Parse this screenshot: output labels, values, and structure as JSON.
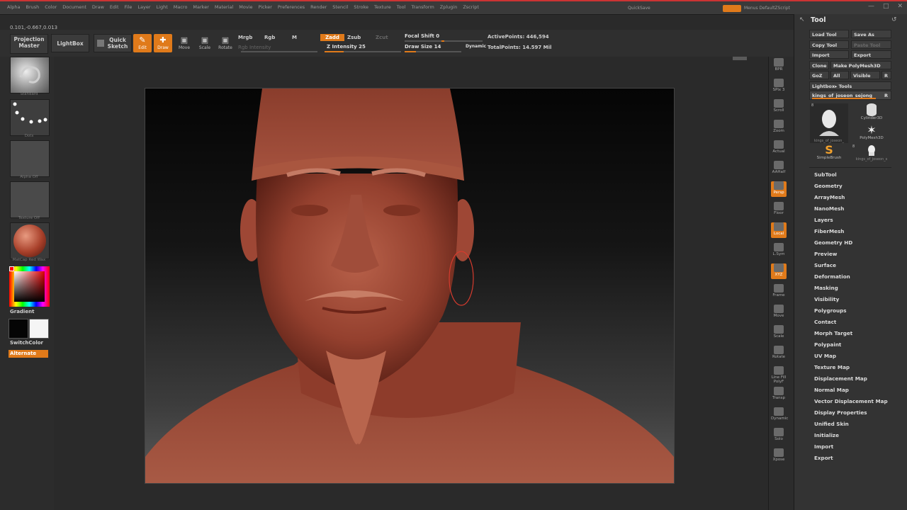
{
  "menu": {
    "items": [
      "Alpha",
      "Brush",
      "Color",
      "Document",
      "Draw",
      "Edit",
      "File",
      "Layer",
      "Light",
      "Macro",
      "Marker",
      "Material",
      "Movie",
      "Picker",
      "Preferences",
      "Render",
      "Stencil",
      "Stroke",
      "Texture",
      "Tool",
      "Transform",
      "Zplugin",
      "Zscript"
    ],
    "coords": "0.101,-0.667,0.013",
    "right_tag": "QuickSave",
    "right_label": "Menus  DefaultZScript"
  },
  "toolbar": {
    "projection_master": "Projection Master",
    "lightbox": "LightBox",
    "quick_sketch": "Quick Sketch",
    "edit": "Edit",
    "draw": "Draw",
    "move": "Move",
    "scale": "Scale",
    "rotate": "Rotate",
    "mrgb": "Mrgb",
    "rgb": "Rgb",
    "m": "M",
    "rgb_intensity": "Rgb Intensity",
    "zadd": "Zadd",
    "zsub": "Zsub",
    "zcut": "Zcut",
    "z_intensity_label": "Z Intensity",
    "z_intensity": 25,
    "focal_shift_label": "Focal Shift",
    "focal_shift": 0,
    "draw_size_label": "Draw Size",
    "draw_size": 14,
    "dynamic": "Dynamic",
    "active_points_label": "ActivePoints:",
    "active_points": "446,594",
    "total_points_label": "TotalPoints:",
    "total_points": "14.597 Mil"
  },
  "left_shelf": {
    "brush_caption": "Standard",
    "stroke_caption": "Dots",
    "alpha_caption": "Alpha Off",
    "texture_caption": "Texture Off",
    "material_caption": "MatCap Red Wax",
    "gradient": "Gradient",
    "switch_color": "SwitchColor",
    "alternate": "Alternate"
  },
  "right_shelf": {
    "buttons": [
      "BPR",
      "SPix 3",
      "Scroll",
      "Zoom",
      "Actual",
      "AAHalf",
      "Persp",
      "Floor",
      "Local",
      "L.Sym",
      "XYZ",
      "Frame",
      "Move",
      "Scale",
      "Rotate",
      "Line Fill PolyF",
      "Transp",
      "Dynamic",
      "Solo",
      "Xpose"
    ]
  },
  "tool_panel": {
    "title": "Tool",
    "load_tool": "Load Tool",
    "save_as": "Save As",
    "copy_tool": "Copy Tool",
    "paste_tool": "Paste Tool",
    "import": "Import",
    "export": "Export",
    "clone": "Clone",
    "make_polymesh": "Make PolyMesh3D",
    "goz": "GoZ",
    "all": "All",
    "visible": "Visible",
    "r": "R",
    "lightbox_tools": "Lightbox▸ Tools",
    "current_tool": "kings_of_joseon_sejong_",
    "thumbs": [
      {
        "label": "kings_of_joseon_",
        "count": "8"
      },
      {
        "label": "Cylinder3D",
        "count": ""
      },
      {
        "label": "PolyMesh3D",
        "count": ""
      },
      {
        "label": "SimpleBrush",
        "count": ""
      },
      {
        "label": "kings_of_joseon_s",
        "count": "8"
      }
    ],
    "menu": [
      "SubTool",
      "Geometry",
      "ArrayMesh",
      "NanoMesh",
      "Layers",
      "FiberMesh",
      "Geometry HD",
      "Preview",
      "Surface",
      "Deformation",
      "Masking",
      "Visibility",
      "Polygroups",
      "Contact",
      "Morph Target",
      "Polypaint",
      "UV Map",
      "Texture Map",
      "Displacement Map",
      "Normal Map",
      "Vector Displacement Map",
      "Display Properties",
      "Unified Skin",
      "Initialize",
      "Import",
      "Export"
    ]
  },
  "colors": {
    "accent": "#e07a1a",
    "clay": "#9c4a38",
    "panel": "#333333"
  }
}
